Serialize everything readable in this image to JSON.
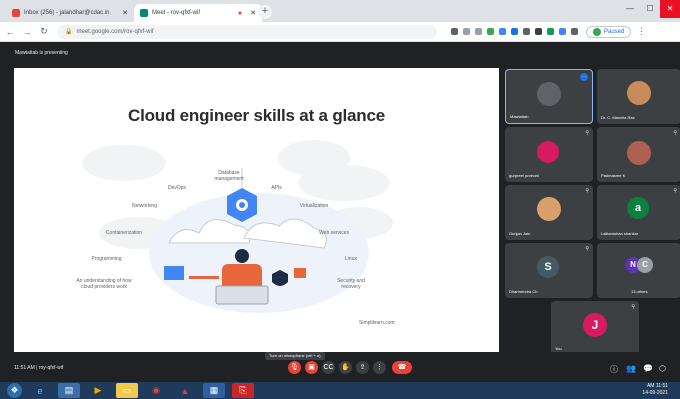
{
  "browser": {
    "tab1_title": "Inbox (256) - jalandhar@cdac.in",
    "tab2_title": "Meet - rov-qfxf-wif",
    "address": "meet.google.com/rov-qfxf-wif",
    "paused_label": "Paused",
    "minimize": "—",
    "maximize": "☐",
    "close": "✕"
  },
  "meet": {
    "presenting_label": "Mawtattab is presenting",
    "meeting_info": "11:51 AM | roy-qfxf-wif",
    "tooltip": "Turn on microphone (ctrl + d)"
  },
  "slide": {
    "title": "Cloud engineer skills at a glance",
    "skills": {
      "database": "Database management",
      "devops": "DevOps",
      "apis": "APIs",
      "networking": "Networking",
      "virtualization": "Virtualization",
      "containerization": "Containerization",
      "web_services": "Web services",
      "programming": "Programming",
      "linux": "Linux",
      "os_understanding": "An understanding of how cloud providers work",
      "security": "Security and recovery"
    },
    "source": "Simplilearn.com"
  },
  "participants": [
    {
      "name": "Mawtattab",
      "initial": ""
    },
    {
      "name": "Dr. C. Mannila Ras",
      "initial": ""
    },
    {
      "name": "gurpreet pnrecell",
      "initial": ""
    },
    {
      "name": "Padmasree K",
      "initial": ""
    },
    {
      "name": "Gunjan Jain",
      "initial": ""
    },
    {
      "name": "Lalitamohan shankar",
      "initial": "a"
    },
    {
      "name": "Dharmendra Ch",
      "initial": "S"
    },
    {
      "name": "13 others",
      "initial": "N"
    },
    {
      "name": "You",
      "initial": "J"
    }
  ],
  "taskbar": {
    "time": "AM 11:51",
    "date": "14-09-2021"
  },
  "colors": {
    "hangup": "#ea4335",
    "accent": "#1a73e8",
    "tile_bg": "#3c4043"
  }
}
